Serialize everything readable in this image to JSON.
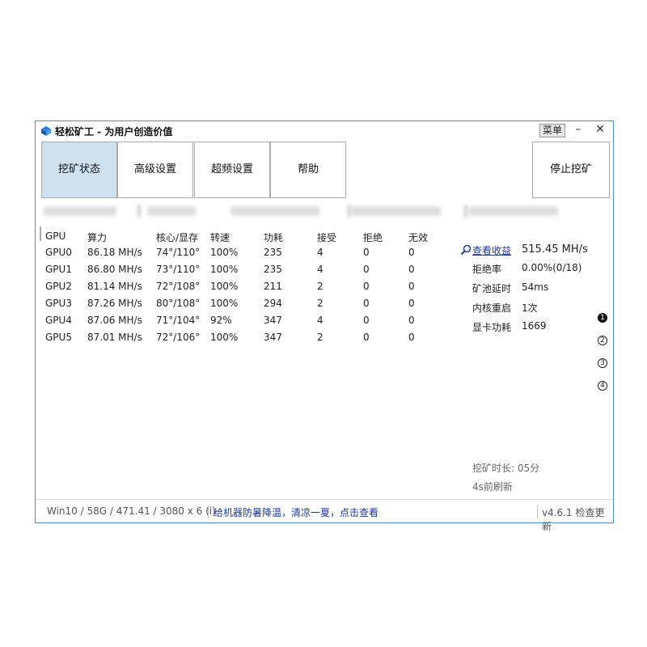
{
  "window": {
    "title": "轻松矿工 - 为用户创造价值",
    "menu_label": "菜单",
    "minimize": "–",
    "close": "✕",
    "accent": "#4a90d9"
  },
  "tabs": [
    "挖矿状态",
    "高级设置",
    "超频设置",
    "帮助"
  ],
  "stop_button": "停止挖矿",
  "table": {
    "headers": [
      "GPU",
      "算力",
      "核心/显存",
      "转速",
      "功耗",
      "接受",
      "拒绝",
      "无效"
    ],
    "rows": [
      [
        "GPU0",
        "86.18 MH/s",
        "74°/110°",
        "100%",
        "235",
        "4",
        "0",
        "0"
      ],
      [
        "GPU1",
        "86.80 MH/s",
        "73°/110°",
        "100%",
        "235",
        "4",
        "0",
        "0"
      ],
      [
        "GPU2",
        "81.14 MH/s",
        "72°/108°",
        "100%",
        "211",
        "2",
        "0",
        "0"
      ],
      [
        "GPU3",
        "87.26 MH/s",
        "80°/108°",
        "100%",
        "294",
        "2",
        "0",
        "0"
      ],
      [
        "GPU4",
        "87.06 MH/s",
        "71°/104°",
        "92%",
        "347",
        "4",
        "0",
        "0"
      ],
      [
        "GPU5",
        "87.01 MH/s",
        "72°/106°",
        "100%",
        "347",
        "2",
        "0",
        "0"
      ]
    ]
  },
  "summary": {
    "earnings_link": "查看收益",
    "total_hashrate": "515.45 MH/s",
    "reject_label": "拒绝率",
    "reject_value": "0.00%(0/18)",
    "latency_label": "矿池延时",
    "latency_value": "54ms",
    "restart_label": "内核重启",
    "restart_value": "1次",
    "power_label": "显卡功耗",
    "power_value": "1669"
  },
  "pages": [
    "1",
    "2",
    "3",
    "4"
  ],
  "mining_time": "挖矿时长:   05分",
  "refresh_text": "4s前刷新",
  "status": {
    "system": "Win10  / 58G / 471.41 / 3080 x 6 (i)",
    "promo": "给机器防暑降温，清凉一夏，点击查看",
    "version": "v4.6.1 检查更新"
  }
}
